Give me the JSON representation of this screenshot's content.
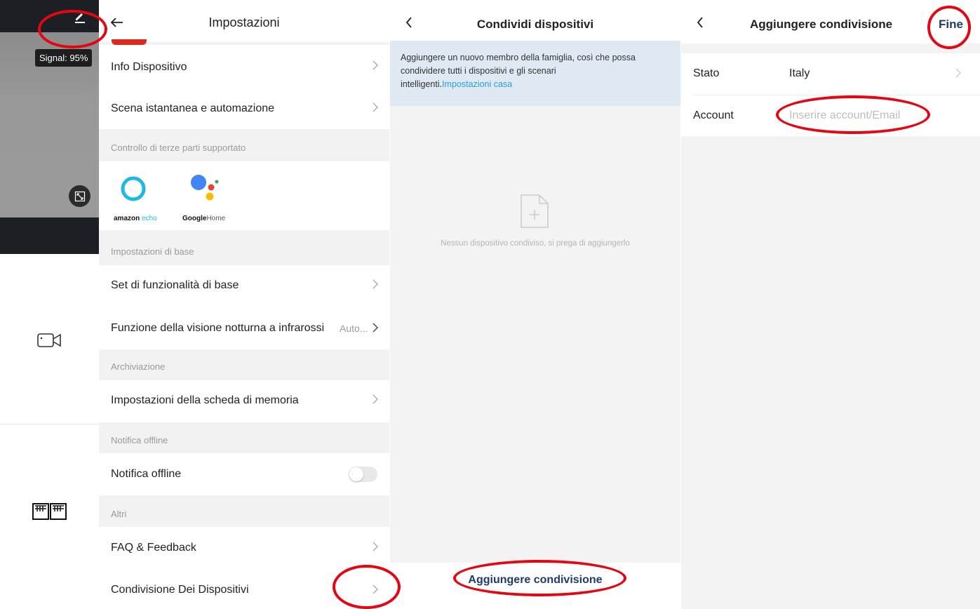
{
  "colors": {
    "accent_red": "#e30613",
    "link_blue": "#2f9bd8",
    "navy": "#1f3a6b",
    "info_bg": "#dee9f4"
  },
  "camera": {
    "signal_label": "Signal: 95%",
    "icons": [
      "edit-icon",
      "expand-icon",
      "video-camera-icon",
      "gallery-icon"
    ]
  },
  "settings": {
    "title": "Impostazioni",
    "rows": {
      "info": "Info Dispositivo",
      "scena": "Scena istantanea e automazione",
      "base_set": "Set di funzionalità di base",
      "night_vision": "Funzione della visione notturna a infrarossi",
      "night_vision_value": "Auto...",
      "memory": "Impostazioni della scheda di memoria",
      "offline": "Notifica offline",
      "faq": "FAQ & Feedback",
      "sharing": "Condivisione Dei Dispositivi"
    },
    "sections": {
      "third_party": "Controllo di terze parti supportato",
      "base": "Impostazioni di base",
      "storage": "Archiviazione",
      "offline": "Notifica offline",
      "others": "Altri"
    },
    "third_party": {
      "amazon_a": "amazon",
      "amazon_b": "echo",
      "google_a": "Google",
      "google_b": "Home"
    },
    "offline_toggle_on": false
  },
  "share": {
    "title": "Condividi dispositivi",
    "info_text": "Aggiungere un nuovo membro della famiglia, così che possa condividere tutti i dispositivi e gli scenari intelligenti.",
    "info_link": "Impostazioni casa",
    "empty_message": "Nessun dispositivo condiviso, si prega di aggiungerlo",
    "add_button": "Aggiungere condivisione"
  },
  "add_share": {
    "title": "Aggiungere condivisione",
    "done": "Fine",
    "stato_label": "Stato",
    "stato_value": "Italy",
    "account_label": "Account",
    "account_placeholder": "Inserire account/Email"
  }
}
